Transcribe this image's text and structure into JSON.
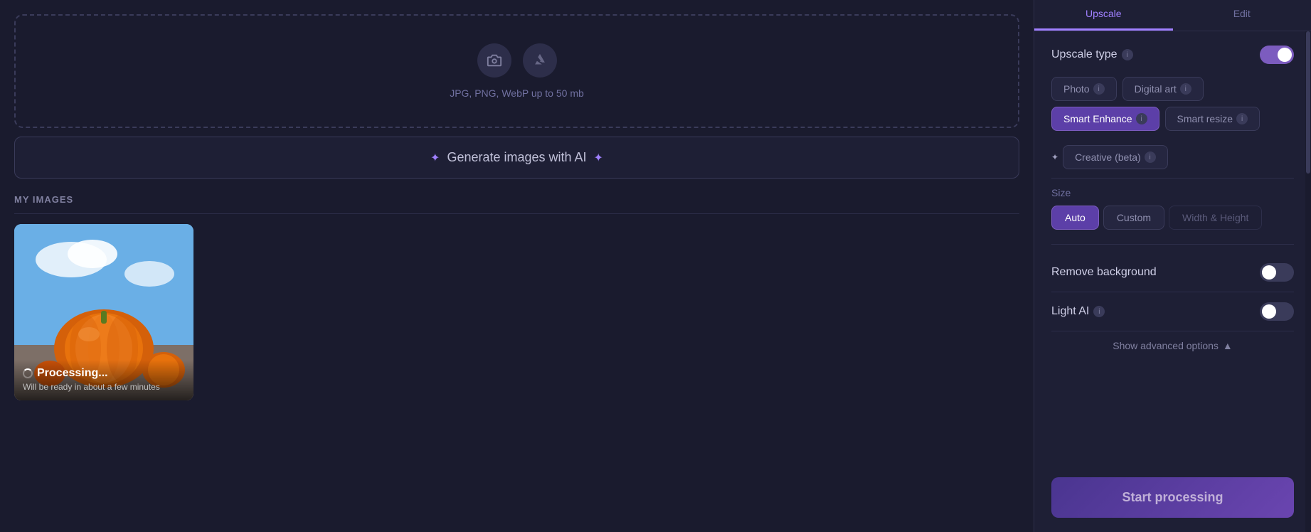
{
  "upload": {
    "hint": "JPG, PNG, WebP up to 50 mb",
    "file_icon": "📁",
    "drive_icon": "☁"
  },
  "generate_btn": {
    "label": "Generate images with AI",
    "sparkle_left": "✦",
    "sparkle_right": "✦"
  },
  "my_images": {
    "label": "MY IMAGES"
  },
  "image_card": {
    "processing_label": "Processing...",
    "processing_sub": "Will be ready in about a few minutes"
  },
  "tabs": [
    {
      "label": "Upscale",
      "active": true
    },
    {
      "label": "Edit",
      "active": false
    }
  ],
  "panel": {
    "upscale_type_label": "Upscale type",
    "upscale_toggle": "on",
    "type_buttons": [
      {
        "label": "Photo",
        "active": false,
        "has_info": true
      },
      {
        "label": "Digital art",
        "active": false,
        "has_info": true
      },
      {
        "label": "Smart Enhance",
        "active": true,
        "has_info": true
      },
      {
        "label": "Smart resize",
        "active": false,
        "has_info": true
      }
    ],
    "creative_label": "Creative (beta)",
    "size_label": "Size",
    "size_buttons": [
      {
        "label": "Auto",
        "active": true
      },
      {
        "label": "Custom",
        "active": false
      },
      {
        "label": "Width & Height",
        "active": false,
        "ghost": true
      }
    ],
    "remove_background_label": "Remove background",
    "remove_background_toggle": "off",
    "light_ai_label": "Light AI",
    "light_ai_toggle": "off",
    "show_advanced": "Show advanced options",
    "start_processing": "Start processing",
    "chevron_up": "▲"
  }
}
